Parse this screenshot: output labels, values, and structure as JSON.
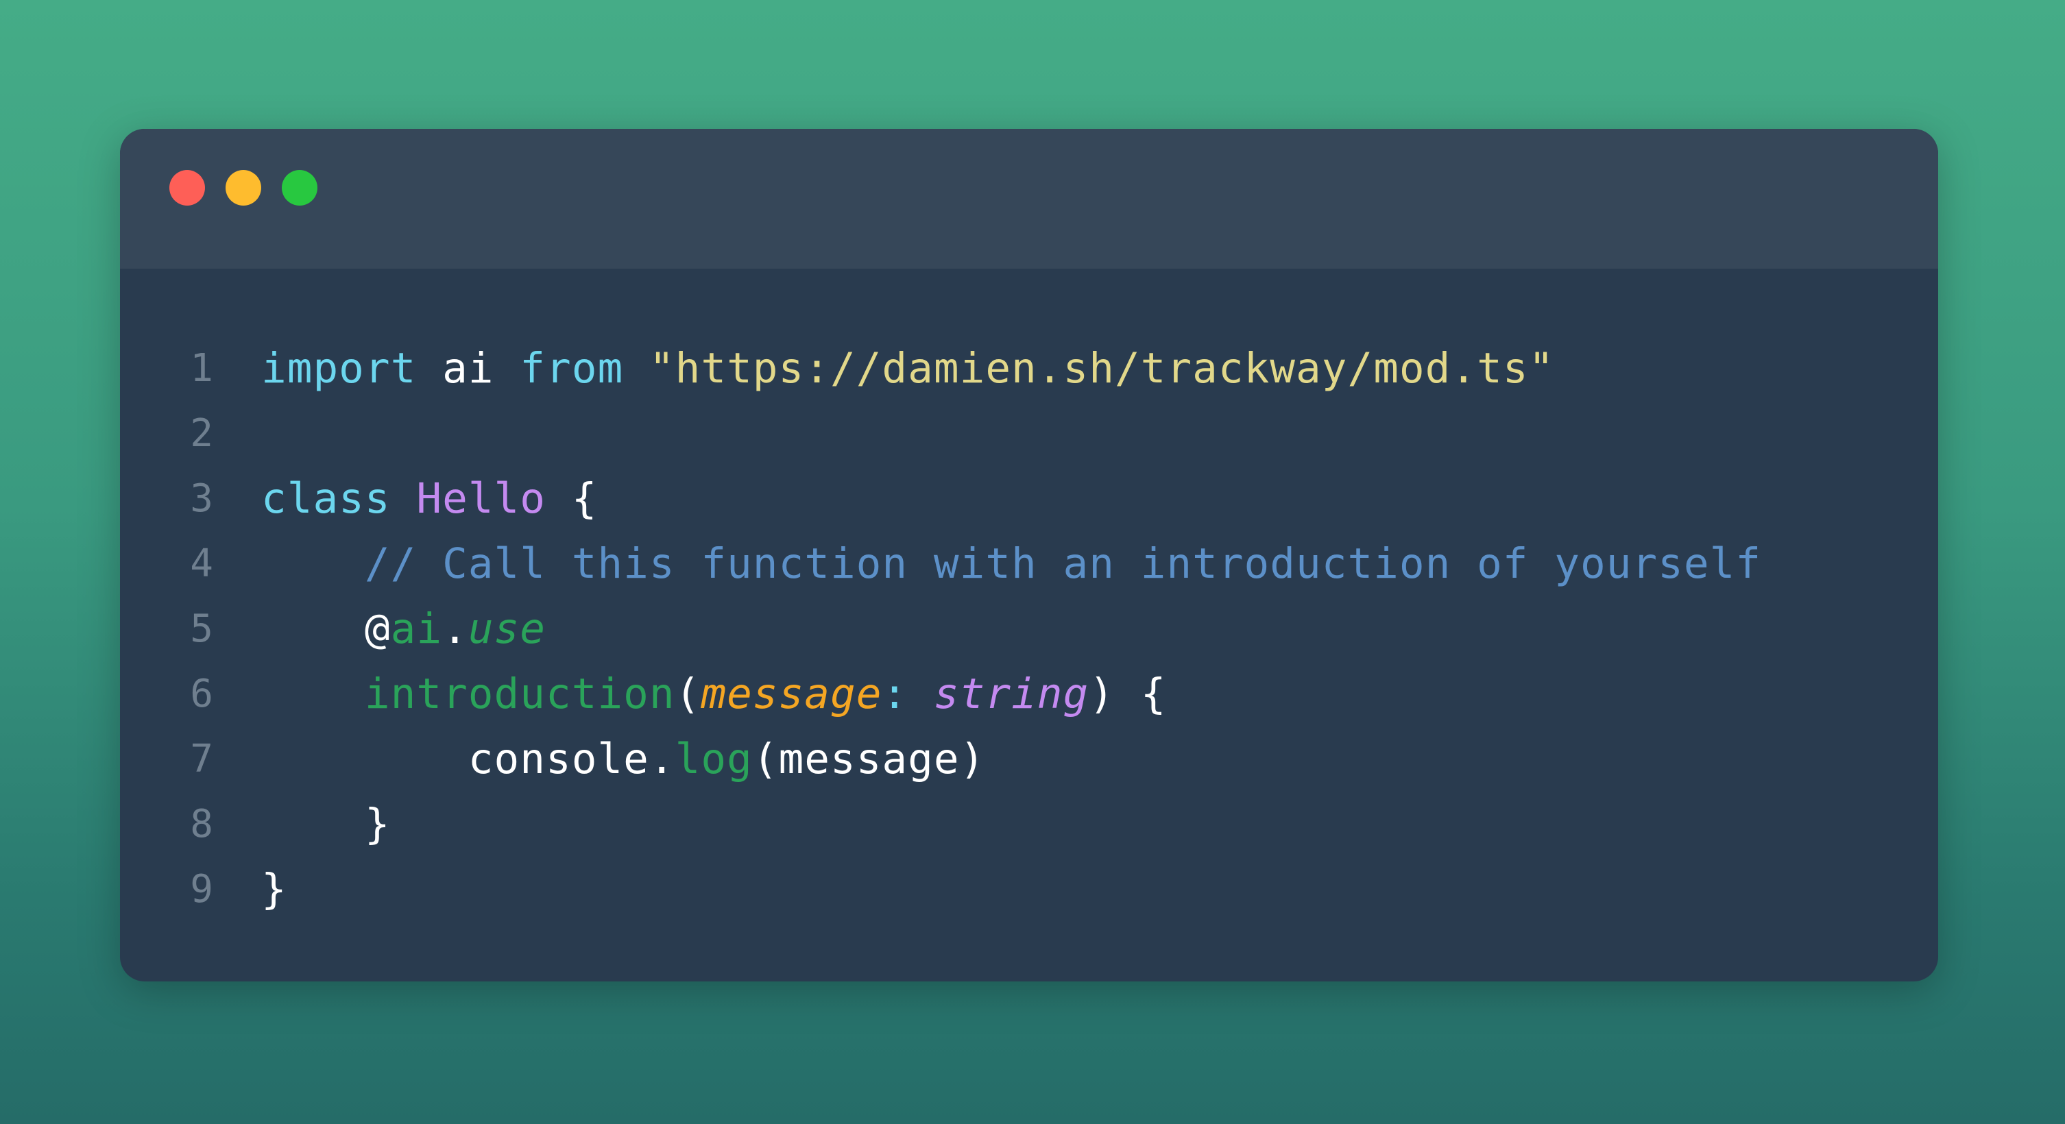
{
  "colors": {
    "background_top": "#45ac87",
    "background_bottom": "#256c68",
    "window": "#293b4f",
    "titlebar": "#364759",
    "close": "#fe5f57",
    "minimize": "#febc2e",
    "maximize": "#28c840"
  },
  "lines": [
    {
      "num": "1",
      "tokens": [
        [
          "kw",
          "import"
        ],
        [
          "pl",
          " ai "
        ],
        [
          "kw",
          "from"
        ],
        [
          "pl",
          " "
        ],
        [
          "str",
          "\"https://damien.sh/trackway/mod.ts\""
        ]
      ]
    },
    {
      "num": "2",
      "tokens": []
    },
    {
      "num": "3",
      "tokens": [
        [
          "kw",
          "class"
        ],
        [
          "pl",
          " "
        ],
        [
          "cls",
          "Hello"
        ],
        [
          "pl",
          " {"
        ]
      ]
    },
    {
      "num": "4",
      "tokens": [
        [
          "pl",
          "    "
        ],
        [
          "cmt",
          "// Call this function with an introduction of yourself"
        ]
      ]
    },
    {
      "num": "5",
      "tokens": [
        [
          "pl",
          "    @"
        ],
        [
          "fn",
          "ai"
        ],
        [
          "pl",
          "."
        ],
        [
          "fn it",
          "use"
        ]
      ]
    },
    {
      "num": "6",
      "tokens": [
        [
          "pl",
          "    "
        ],
        [
          "fn",
          "introduction"
        ],
        [
          "pl",
          "("
        ],
        [
          "param",
          "message"
        ],
        [
          "kw",
          ":"
        ],
        [
          "pl",
          " "
        ],
        [
          "type",
          "string"
        ],
        [
          "pl",
          ") {"
        ]
      ]
    },
    {
      "num": "7",
      "tokens": [
        [
          "pl",
          "        console."
        ],
        [
          "fn",
          "log"
        ],
        [
          "pl",
          "(message)"
        ]
      ]
    },
    {
      "num": "8",
      "tokens": [
        [
          "pl",
          "    }"
        ]
      ]
    },
    {
      "num": "9",
      "tokens": [
        [
          "pl",
          "}"
        ]
      ]
    }
  ]
}
